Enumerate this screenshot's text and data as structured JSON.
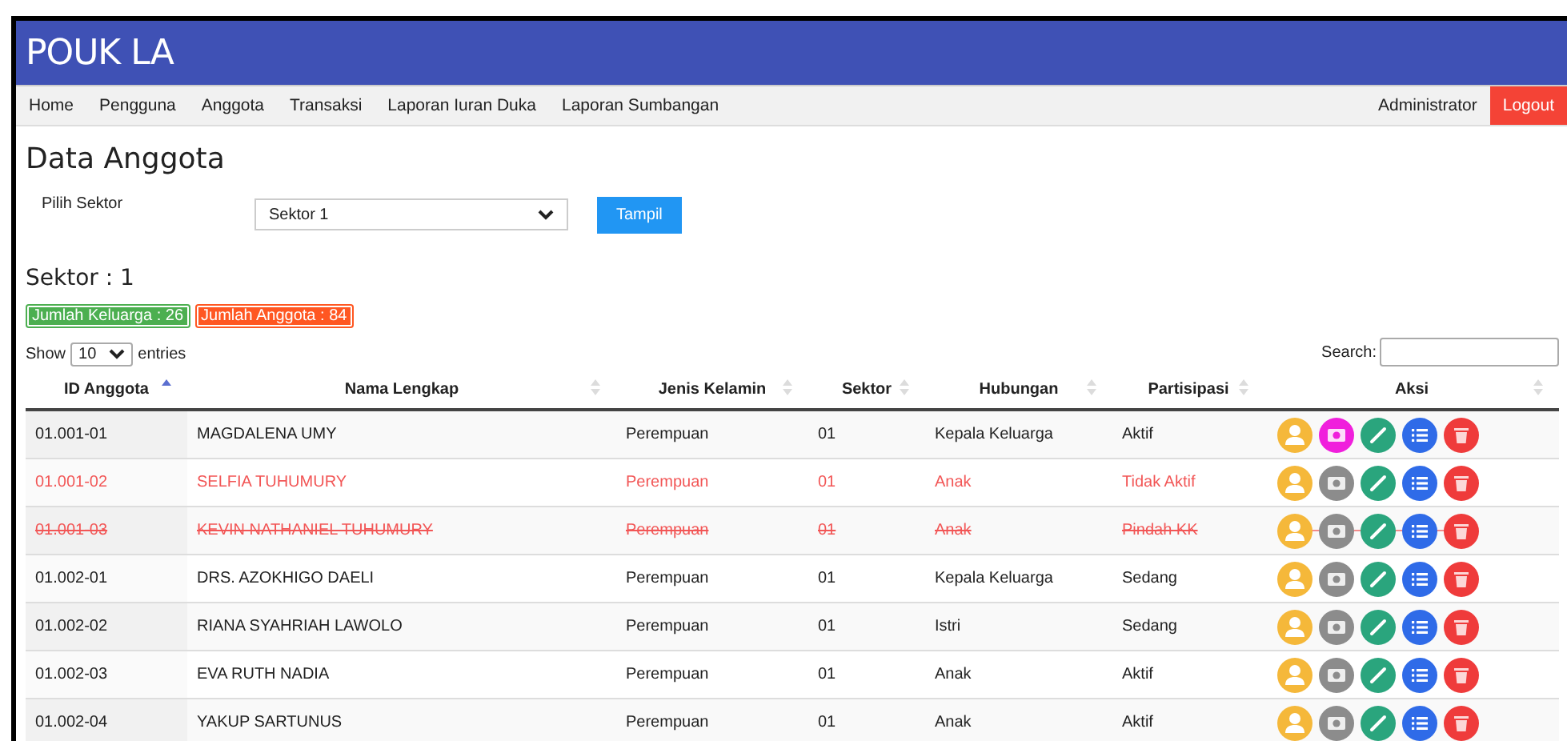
{
  "app_title": "POUK LA",
  "nav": {
    "items": [
      "Home",
      "Pengguna",
      "Anggota",
      "Transaksi",
      "Laporan Iuran Duka",
      "Laporan Sumbangan"
    ],
    "user": "Administrator",
    "logout": "Logout"
  },
  "page_title": "Data Anggota",
  "filter": {
    "label": "Pilih Sektor",
    "value": "Sektor 1",
    "button": "Tampil"
  },
  "sector_heading": "Sektor : 1",
  "badges": [
    {
      "text": "Jumlah Keluarga : 26",
      "color": "#4caf50"
    },
    {
      "text": "Jumlah Anggota : 84",
      "color": "#ff5722"
    }
  ],
  "length": {
    "before": "Show",
    "value": "10",
    "after": "entries"
  },
  "search": {
    "label": "Search:"
  },
  "table": {
    "columns": [
      {
        "label": "ID Anggota",
        "sorted": true
      },
      {
        "label": "Nama Lengkap",
        "sorted": false
      },
      {
        "label": "Jenis Kelamin",
        "sorted": false
      },
      {
        "label": "Sektor",
        "sorted": false
      },
      {
        "label": "Hubungan",
        "sorted": false
      },
      {
        "label": "Partisipasi",
        "sorted": false
      },
      {
        "label": "Aksi",
        "sorted": false
      }
    ],
    "rows": [
      {
        "cells": [
          "01.001-01",
          "MAGDALENA UMY",
          "Perempuan",
          "01",
          "Kepala Keluarga",
          "Aktif"
        ],
        "inactive": false,
        "struck_through": false,
        "has_photo": true
      },
      {
        "cells": [
          "01.001-02",
          "SELFIA TUHUMURY",
          "Perempuan",
          "01",
          "Anak",
          "Tidak Aktif"
        ],
        "inactive": true,
        "struck_through": false,
        "has_photo": false
      },
      {
        "cells": [
          "01.001-03",
          "KEVIN NATHANIEL TUHUMURY",
          "Perempuan",
          "01",
          "Anak",
          "Pindah KK"
        ],
        "inactive": true,
        "struck_through": true,
        "has_photo": false
      },
      {
        "cells": [
          "01.002-01",
          "DRS. AZOKHIGO DAELI",
          "Perempuan",
          "01",
          "Kepala Keluarga",
          "Sedang"
        ],
        "inactive": false,
        "struck_through": false,
        "has_photo": false
      },
      {
        "cells": [
          "01.002-02",
          "RIANA SYAHRIAH LAWOLO",
          "Perempuan",
          "01",
          "Istri",
          "Sedang"
        ],
        "inactive": false,
        "struck_through": false,
        "has_photo": false
      },
      {
        "cells": [
          "01.002-03",
          "EVA RUTH NADIA",
          "Perempuan",
          "01",
          "Anak",
          "Aktif"
        ],
        "inactive": false,
        "struck_through": false,
        "has_photo": false
      },
      {
        "cells": [
          "01.002-04",
          "YAKUP SARTUNUS",
          "Perempuan",
          "01",
          "Anak",
          "Aktif"
        ],
        "inactive": false,
        "struck_through": false,
        "has_photo": false
      }
    ]
  }
}
